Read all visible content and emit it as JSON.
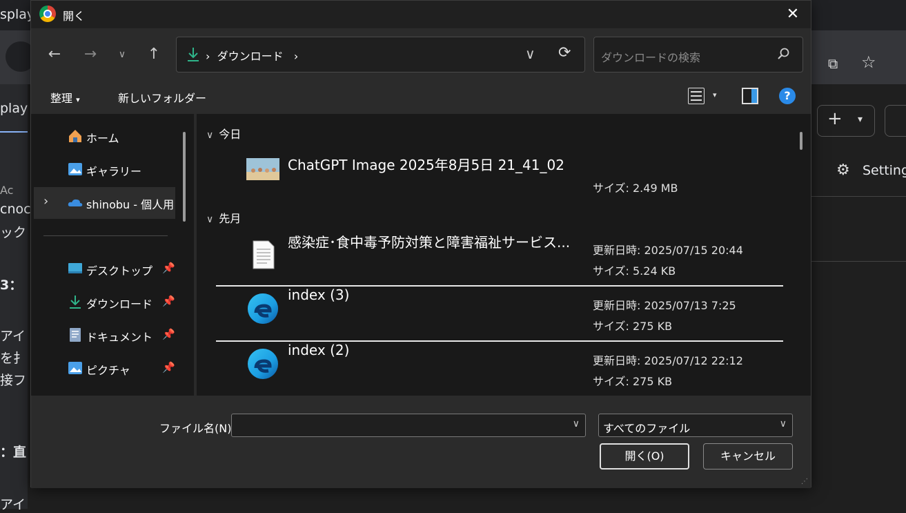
{
  "background": {
    "tab_partial": "splay",
    "left_texts": [
      "play",
      "Ac",
      "cnoc",
      "ック",
      "3：",
      "アイ",
      "を扌",
      "接フ",
      "：直",
      "アイ"
    ],
    "settings_label": "Setting"
  },
  "dialog": {
    "title": "開く",
    "address": {
      "path": "ダウンロード",
      "separator": "›"
    },
    "search_placeholder": "ダウンロードの検索",
    "toolbar": {
      "organize": "整理",
      "new_folder": "新しいフォルダー"
    },
    "sidebar": {
      "items": [
        {
          "label": "ホーム",
          "icon": "home-icon"
        },
        {
          "label": "ギャラリー",
          "icon": "gallery-icon"
        },
        {
          "label": "shinobu - 個人用",
          "icon": "onedrive-icon"
        },
        {
          "label": "デスクトップ",
          "icon": "desktop-icon"
        },
        {
          "label": "ダウンロード",
          "icon": "download-icon"
        },
        {
          "label": "ドキュメント",
          "icon": "document-icon"
        },
        {
          "label": "ピクチャ",
          "icon": "pictures-icon"
        }
      ]
    },
    "groups": [
      {
        "label": "今日"
      },
      {
        "label": "先月"
      }
    ],
    "files": [
      {
        "name": "ChatGPT Image 2025年8月5日 21_41_02",
        "modified": "",
        "size": "サイズ: 2.49 MB",
        "icon": "image-thumbnail"
      },
      {
        "name": "感染症･食中毒予防対策と障害福祉サービス...",
        "modified": "更新日時: 2025/07/15 20:44",
        "size": "サイズ: 5.24 KB",
        "icon": "text-file-icon"
      },
      {
        "name": "index (3)",
        "modified": "更新日時: 2025/07/13 7:25",
        "size": "サイズ: 275 KB",
        "icon": "edge-icon"
      },
      {
        "name": "index (2)",
        "modified": "更新日時: 2025/07/12 22:12",
        "size": "サイズ: 275 KB",
        "icon": "edge-icon"
      }
    ],
    "footer": {
      "filename_label": "ファイル名(N):",
      "filename_value": "",
      "filetype": "すべてのファイル",
      "open_button": "開く(O)",
      "cancel_button": "キャンセル"
    }
  }
}
